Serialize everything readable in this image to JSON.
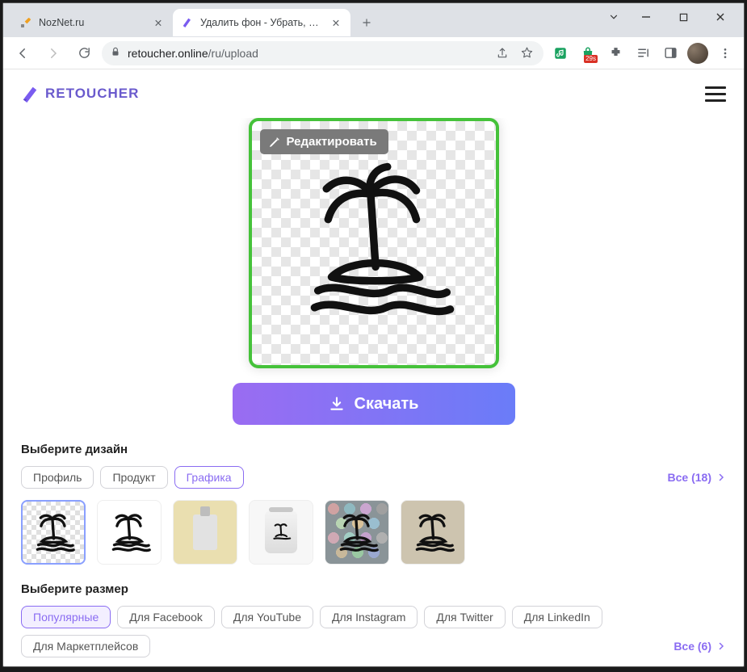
{
  "titlebar": {
    "tabs": [
      {
        "label": "NozNet.ru",
        "active": false
      },
      {
        "label": "Удалить фон - Убрать, вырезать",
        "active": true
      }
    ]
  },
  "toolbar": {
    "url_host": "retoucher.online",
    "url_path": "/ru/upload",
    "ext_badge": "29s"
  },
  "header": {
    "brand": "RETOUCHER"
  },
  "preview": {
    "edit_label": "Редактировать",
    "download_label": "Скачать"
  },
  "design": {
    "title": "Выберите дизайн",
    "chips": [
      "Профиль",
      "Продукт",
      "Графика"
    ],
    "active_chip": 2,
    "see_all_label": "Все (18)"
  },
  "size": {
    "title": "Выберите размер",
    "chips": [
      "Популярные",
      "Для Facebook",
      "Для YouTube",
      "Для Instagram",
      "Для Twitter",
      "Для LinkedIn",
      "Для Маркетплейсов"
    ],
    "active_chip": 0,
    "see_all_label": "Все (6)"
  }
}
